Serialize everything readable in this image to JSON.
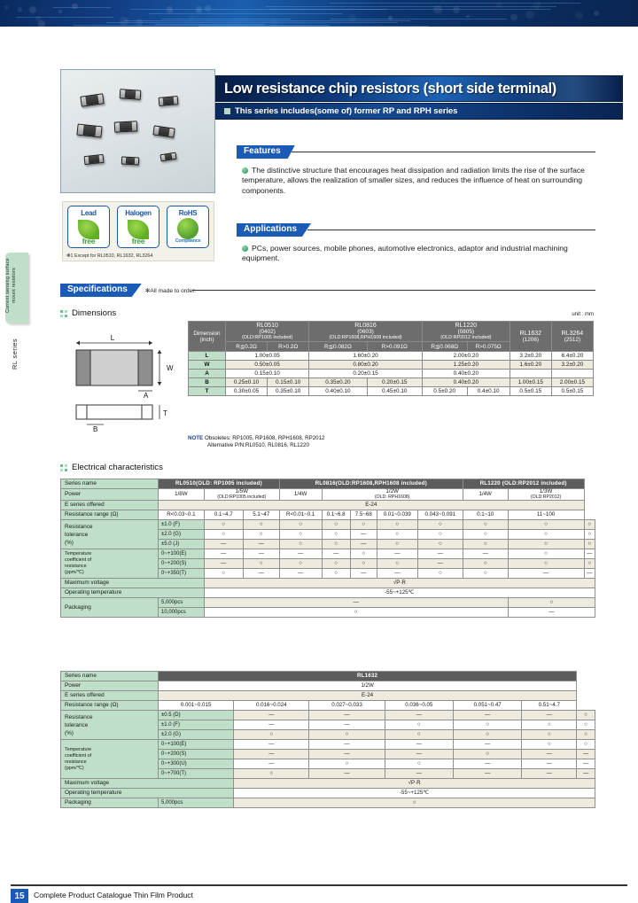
{
  "header": {
    "title": "Low resistance chip resistors (short side terminal)",
    "subtitle": "This series includes(some of) former RP and RPH series"
  },
  "sidebar": {
    "tab_label": "Current sensing surface mount resistors",
    "series_label": "RL series"
  },
  "features": {
    "heading": "Features",
    "body": "The distinctive structure that encourages heat dissipation and radiation limits the rise of the surface temperature, allows the realization of smaller sizes, and reduces the influence of heat on surrounding components."
  },
  "applications": {
    "heading": "Applications",
    "body": "PCs, power sources, mobile phones, automotive electronics, adaptor and industrial machining equipment."
  },
  "badges": {
    "lead": {
      "top": "Lead",
      "bottom": "free"
    },
    "halogen": {
      "top": "Halogen",
      "bottom": "free"
    },
    "rohs": {
      "top": "RoHS",
      "bottom": "Compliance"
    },
    "note": "✻1  Except for RL0510, RL1632, RL3264"
  },
  "specifications": {
    "heading": "Specifications",
    "note": "✻All made to order.",
    "dimensions_heading": "Dimensions",
    "electrical_heading": "Electrical characteristics"
  },
  "dimensions": {
    "unit_note": "unit : mm",
    "corner_label_1": "Dimension",
    "corner_label_2": "(inch)",
    "columns": [
      {
        "name": "RL0510",
        "inch": "(0402)",
        "old": "(OLD:RP1005 included)",
        "span": 2,
        "subs": [
          "R≦0.2Ω",
          "R>0.2Ω"
        ]
      },
      {
        "name": "RL0816",
        "inch": "(0603)",
        "old": "(OLD:RP1608,RPH1608 included)",
        "span": 2,
        "subs": [
          "R≦0.082Ω",
          "R>0.091Ω"
        ]
      },
      {
        "name": "RL1220",
        "inch": "(0805)",
        "old": "(OLD:RP2012 included)",
        "span": 2,
        "subs": [
          "R≦0.068Ω",
          "R>0.075Ω"
        ]
      },
      {
        "name": "RL1632",
        "inch": "(1206)",
        "old": "",
        "span": 1,
        "subs": [
          ""
        ]
      },
      {
        "name": "RL3264",
        "inch": "(2512)",
        "old": "",
        "span": 1,
        "subs": [
          ""
        ]
      }
    ],
    "rows": [
      {
        "label": "L",
        "cells": [
          {
            "v": "1.00±0.05",
            "span": 2
          },
          {
            "v": "1.60±0.20",
            "span": 2
          },
          {
            "v": "2.00±0.20",
            "span": 2
          },
          {
            "v": "3.2±0.20",
            "span": 1
          },
          {
            "v": "6.4±0.20",
            "span": 1
          }
        ]
      },
      {
        "label": "W",
        "cells": [
          {
            "v": "0.50±0.05",
            "span": 2
          },
          {
            "v": "0.80±0.20",
            "span": 2
          },
          {
            "v": "1.25±0.20",
            "span": 2
          },
          {
            "v": "1.6±0.20",
            "span": 1
          },
          {
            "v": "3.2±0.20",
            "span": 1
          }
        ]
      },
      {
        "label": "A",
        "cells": [
          {
            "v": "0.15±0.10",
            "span": 2
          },
          {
            "v": "0.20±0.15",
            "span": 2
          },
          {
            "v": "0.40±0.20",
            "span": 2
          },
          {
            "v": "",
            "span": 1
          },
          {
            "v": "",
            "span": 1
          }
        ]
      },
      {
        "label": "B",
        "cells": [
          {
            "v": "0.25±0.10",
            "span": 1
          },
          {
            "v": "0.15±0.10",
            "span": 1
          },
          {
            "v": "0.35±0.20",
            "span": 1
          },
          {
            "v": "0.20±0.15",
            "span": 1
          },
          {
            "v": "0.40±0.20",
            "span": 2
          },
          {
            "v": "1.00±0.15",
            "span": 1
          },
          {
            "v": "2.00±0.15",
            "span": 1
          }
        ]
      },
      {
        "label": "T",
        "cells": [
          {
            "v": "0.30±0.05",
            "span": 1
          },
          {
            "v": "0.35±0.10",
            "span": 1
          },
          {
            "v": "0.40±0.10",
            "span": 1
          },
          {
            "v": "0.45±0.10",
            "span": 1
          },
          {
            "v": "0.5±0.20",
            "span": 1
          },
          {
            "v": "0.4±0.10",
            "span": 1
          },
          {
            "v": "0.5±0.15",
            "span": 1
          },
          {
            "v": "0.5±0.15",
            "span": 1
          }
        ]
      }
    ],
    "note_label": "NOTE",
    "note_line1": "Obsoletes: RP1005, RP1608, RPH1608, RP2012",
    "note_line2": "Alternative P/N:RL0510, RL0816, RL1220"
  },
  "electrical_main": {
    "series_row_label": "Series name",
    "series_groups": [
      {
        "name": "RL0510(OLD: RP1005 included)",
        "span": 3
      },
      {
        "name": "RL0816(OLD:RP1608,RPH1608 included)",
        "span": 5
      },
      {
        "name": "RL1220 (OLD:RP2012 included)",
        "span": 2
      }
    ],
    "rows": {
      "power_label": "Power",
      "power_cells": [
        {
          "v": "1/8W",
          "span": 1
        },
        {
          "v": "1/5W\n(OLD:RP1005 included)",
          "span": 2
        },
        {
          "v": "1/4W",
          "span": 1
        },
        {
          "v": "1/2W\n(OLD: RPH1608)",
          "span": 4
        },
        {
          "v": "1/4W",
          "span": 1
        },
        {
          "v": "1/3W\n(OLD:RP2012)",
          "span": 1
        }
      ],
      "eseries_label": "E series offered",
      "eseries_value": "E-24",
      "range_label": "Resistance range (Ω)",
      "range_cells": [
        "R<0.03~0.1",
        "0.1~4.7",
        "5.1~47",
        "R<0.01~0.1",
        "0.1~6.8",
        "7.5~68",
        "0.01~0.039",
        "0.043~0.091",
        "0.1~10",
        "11~100"
      ],
      "tol_label_1": "Resistance",
      "tol_label_2": "tolerance",
      "tol_label_3": "(%)",
      "tolerances": [
        {
          "label": "±1.0 (F)",
          "marks": [
            "○",
            "○",
            "○",
            "○",
            "○",
            "○",
            "○",
            "○",
            "○",
            "○"
          ]
        },
        {
          "label": "±2.0 (G)",
          "marks": [
            "○",
            "○",
            "○",
            "○",
            "—",
            "○",
            "○",
            "○",
            "○",
            "○"
          ]
        },
        {
          "label": "±5.0 (J)",
          "marks": [
            "—",
            "—",
            "○",
            "○",
            "—",
            "○",
            "○",
            "○",
            "○",
            "○"
          ]
        }
      ],
      "tcr_label_1": "Temperature",
      "tcr_label_2": "coefficient of",
      "tcr_label_3": "resistance",
      "tcr_label_4": "(ppm/℃)",
      "tcr": [
        {
          "label": "0~+100(E)",
          "marks": [
            "—",
            "—",
            "—",
            "—",
            "○",
            "—",
            "—",
            "—",
            "○",
            "—"
          ]
        },
        {
          "label": "0~+200(S)",
          "marks": [
            "—",
            "○",
            "○",
            "○",
            "○",
            "○",
            "—",
            "○",
            "○",
            "○"
          ]
        },
        {
          "label": "0~+350(T)",
          "marks": [
            "○",
            "—",
            "—",
            "○",
            "—",
            "—",
            "○",
            "○",
            "—",
            "—"
          ]
        }
      ],
      "maxv_label": "Maximum voltage",
      "maxv_value": "√P·R",
      "optemp_label": "Operating temperature",
      "optemp_value": "-55~+125℃",
      "pack_label": "Packaging",
      "pack_rows": [
        {
          "label": "5,000pcs",
          "left": "—",
          "right": "○"
        },
        {
          "label": "10,000pcs",
          "left": "○",
          "right": "—"
        }
      ]
    }
  },
  "electrical_rl1632": {
    "series_row_label": "Series name",
    "series_name": "RL1632",
    "power_label": "Power",
    "power_value": "1/2W",
    "eseries_label": "E series offered",
    "eseries_value": "E-24",
    "range_label": "Resistance range (Ω)",
    "range_cells": [
      "0.001~0.015",
      "0.016~0.024",
      "0.027~0.033",
      "0.036~0.05",
      "0.051~0.47",
      "0.51~4.7"
    ],
    "tol_label_1": "Resistance",
    "tol_label_2": "tolerance",
    "tol_label_3": "(%)",
    "tolerances": [
      {
        "label": "±0.5 (D)",
        "marks": [
          "—",
          "—",
          "—",
          "—",
          "—",
          "○"
        ]
      },
      {
        "label": "±1.0 (F)",
        "marks": [
          "—",
          "—",
          "○",
          "○",
          "○",
          "○"
        ]
      },
      {
        "label": "±2.0 (G)",
        "marks": [
          "○",
          "○",
          "○",
          "○",
          "○",
          "○"
        ]
      }
    ],
    "tcr_label_1": "Temperature",
    "tcr_label_2": "coefficient of",
    "tcr_label_3": "resistance",
    "tcr_label_4": "(ppm/℃)",
    "tcr": [
      {
        "label": "0~+100(E)",
        "marks": [
          "—",
          "—",
          "—",
          "—",
          "○",
          "○"
        ]
      },
      {
        "label": "0~+200(S)",
        "marks": [
          "—",
          "—",
          "—",
          "○",
          "—",
          "—"
        ]
      },
      {
        "label": "0~+300(U)",
        "marks": [
          "—",
          "○",
          "○",
          "—",
          "—",
          "—"
        ]
      },
      {
        "label": "0~+700(T)",
        "marks": [
          "○",
          "—",
          "—",
          "—",
          "—",
          "—"
        ]
      }
    ],
    "maxv_label": "Maximum voltage",
    "maxv_value": "√P·R",
    "optemp_label": "Operating temperature",
    "optemp_value": "-55~+125℃",
    "pack_label": "Packaging",
    "pack_value_label": "5,000pcs",
    "pack_value": "○"
  },
  "footer": {
    "page_number": "15",
    "text": "Complete Product Catalogue   Thin Film Product"
  },
  "colors": {
    "accent_blue": "#1a5bb8",
    "header_green": "#bfdfc8",
    "table_gray": "#5c5c5c",
    "beige": "#efeade"
  }
}
